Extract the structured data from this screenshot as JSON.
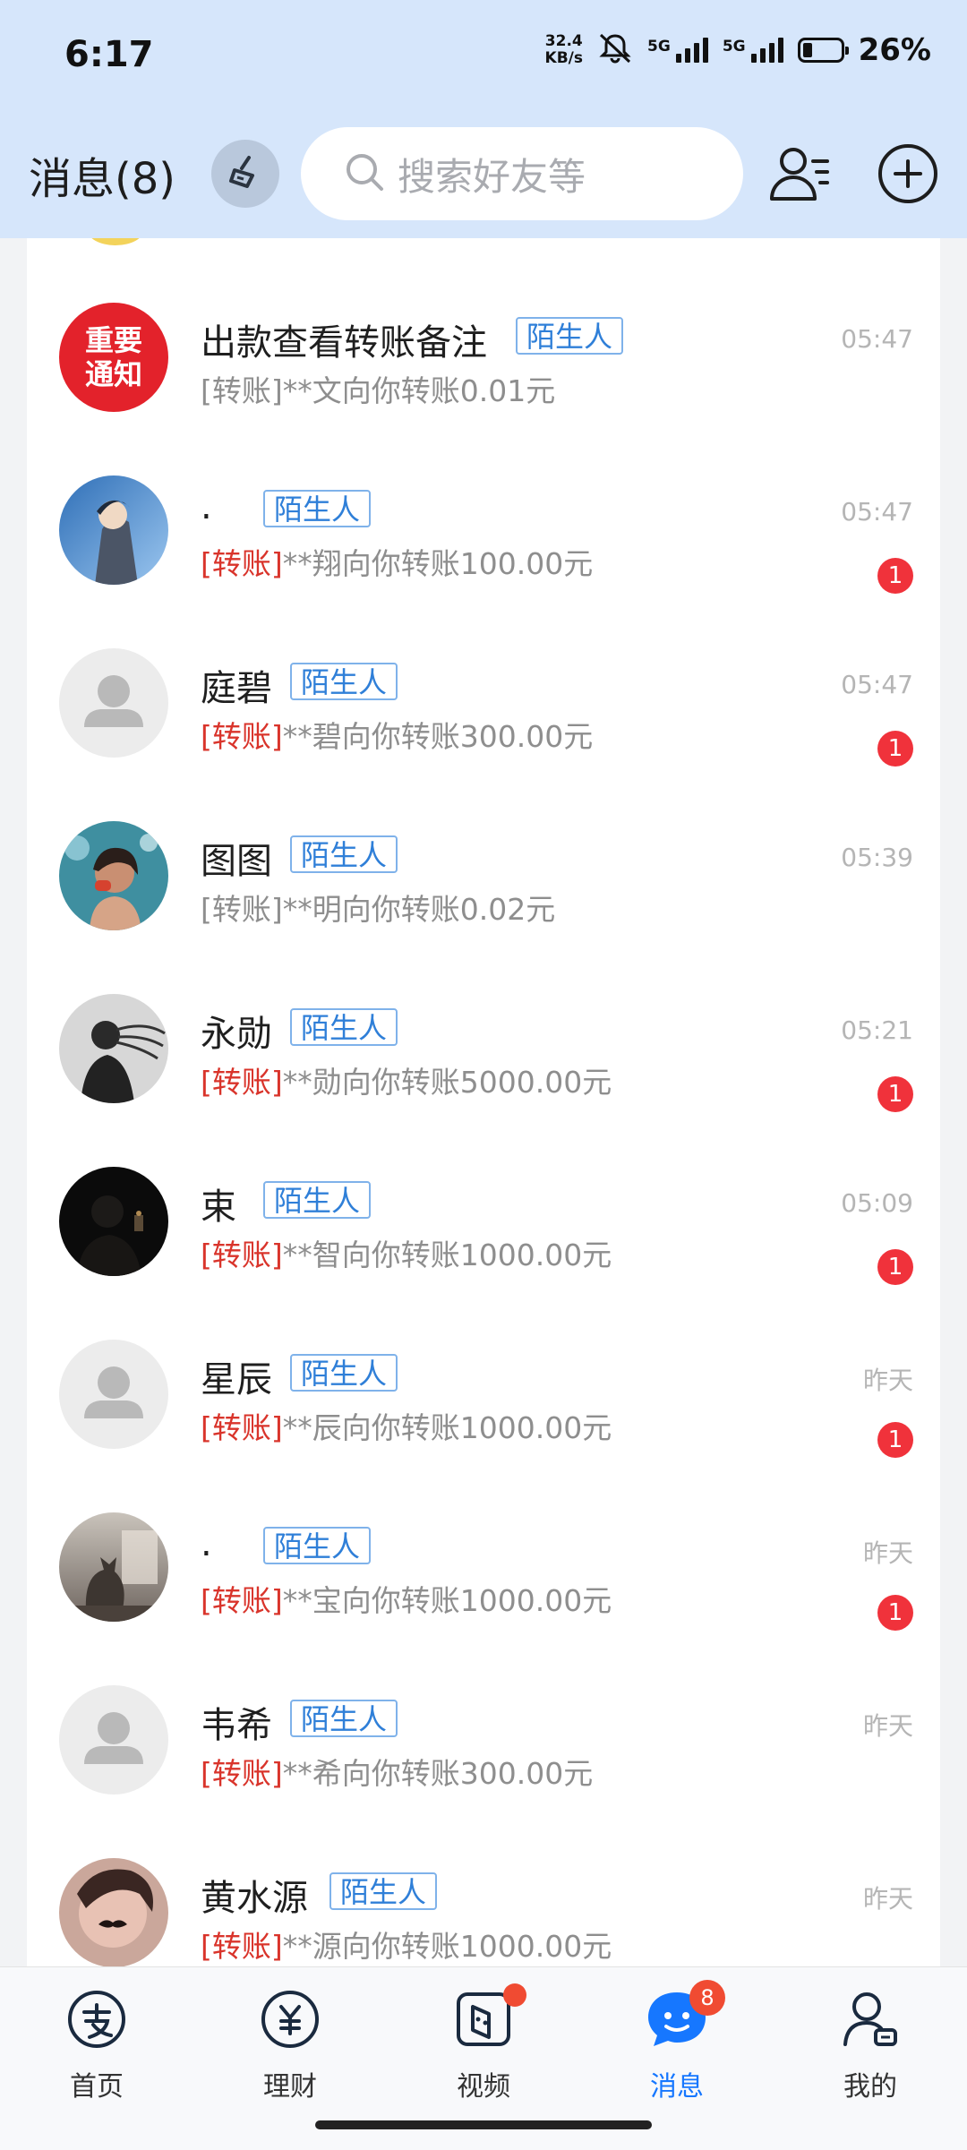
{
  "status": {
    "time": "6:17",
    "net_speed_value": "32.4",
    "net_speed_unit": "KB/s",
    "sim1": "5G",
    "sim2": "5G",
    "battery": "26%"
  },
  "header": {
    "title": "消息(8)",
    "search_placeholder": "搜索好友等"
  },
  "colors": {
    "accent": "#1677ff",
    "tag": "#2f7fd8",
    "red": "#d9342b",
    "badge": "#f0323b",
    "header_bg": "#d6e6fb"
  },
  "conversations": [
    {
      "name": "出款查看转账备注",
      "tag": "陌生人",
      "time": "05:47",
      "prefix": "[转账]",
      "prefix_red": false,
      "text": "**文向你转账0.01元",
      "unread": "",
      "avatar": "important-notice",
      "avatar_text_1": "重要",
      "avatar_text_2": "通知"
    },
    {
      "name": ".",
      "tag": "陌生人",
      "time": "05:47",
      "prefix": "[转账]",
      "prefix_red": true,
      "text": "**翔向你转账100.00元",
      "unread": "1",
      "avatar": "anime-photo"
    },
    {
      "name": "庭碧",
      "tag": "陌生人",
      "time": "05:47",
      "prefix": "[转账]",
      "prefix_red": true,
      "text": "**碧向你转账300.00元",
      "unread": "1",
      "avatar": "default"
    },
    {
      "name": "图图",
      "tag": "陌生人",
      "time": "05:39",
      "prefix": "[转账]",
      "prefix_red": false,
      "text": "**明向你转账0.02元",
      "unread": "",
      "avatar": "portrait-photo"
    },
    {
      "name": "永勋",
      "tag": "陌生人",
      "time": "05:21",
      "prefix": "[转账]",
      "prefix_red": true,
      "text": "**勋向你转账5000.00元",
      "unread": "1",
      "avatar": "silhouette-photo"
    },
    {
      "name": "束",
      "tag": "陌生人",
      "time": "05:09",
      "prefix": "[转账]",
      "prefix_red": true,
      "text": "**智向你转账1000.00元",
      "unread": "1",
      "avatar": "dark-photo"
    },
    {
      "name": "星辰",
      "tag": "陌生人",
      "time": "昨天",
      "prefix": "[转账]",
      "prefix_red": true,
      "text": "**辰向你转账1000.00元",
      "unread": "1",
      "avatar": "default"
    },
    {
      "name": ".",
      "tag": "陌生人",
      "time": "昨天",
      "prefix": "[转账]",
      "prefix_red": true,
      "text": "**宝向你转账1000.00元",
      "unread": "1",
      "avatar": "cat-photo"
    },
    {
      "name": "韦希",
      "tag": "陌生人",
      "time": "昨天",
      "prefix": "[转账]",
      "prefix_red": true,
      "text": "**希向你转账300.00元",
      "unread": "",
      "avatar": "default"
    },
    {
      "name": "黄水源",
      "tag": "陌生人",
      "time": "昨天",
      "prefix": "[转账]",
      "prefix_red": true,
      "text": "**源向你转账1000.00元",
      "unread": "",
      "avatar": "face-photo"
    }
  ],
  "nav": [
    {
      "label": "首页",
      "icon": "alipay-home-icon",
      "active": false,
      "badge": ""
    },
    {
      "label": "理财",
      "icon": "yuan-icon",
      "active": false,
      "badge": ""
    },
    {
      "label": "视频",
      "icon": "video-icon",
      "active": false,
      "badge": "dot"
    },
    {
      "label": "消息",
      "icon": "message-icon",
      "active": true,
      "badge": "8"
    },
    {
      "label": "我的",
      "icon": "profile-icon",
      "active": false,
      "badge": ""
    }
  ]
}
